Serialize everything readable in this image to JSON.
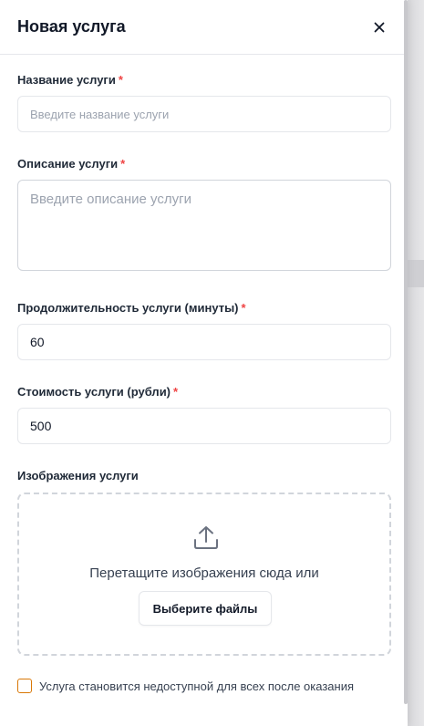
{
  "dialog": {
    "title": "Новая услуга"
  },
  "fields": {
    "name": {
      "label": "Название услуги",
      "required_mark": "*",
      "placeholder": "Введите название услуги",
      "value": ""
    },
    "description": {
      "label": "Описание услуги",
      "required_mark": "*",
      "placeholder": "Введите описание услуги",
      "value": ""
    },
    "duration": {
      "label": "Продолжительность услуги (минуты)",
      "required_mark": "*",
      "value": "60"
    },
    "price": {
      "label": "Стоимость услуги (рубли)",
      "required_mark": "*",
      "value": "500"
    },
    "images": {
      "label": "Изображения услуги",
      "drop_text": "Перетащите изображения сюда или",
      "choose_button": "Выберите файлы"
    }
  },
  "options": {
    "unavailable_after_service": {
      "label": "Услуга становится недоступной для всех после оказания",
      "checked": false
    }
  },
  "colors": {
    "required": "#ef4444",
    "checkbox_border": "#d97706"
  }
}
